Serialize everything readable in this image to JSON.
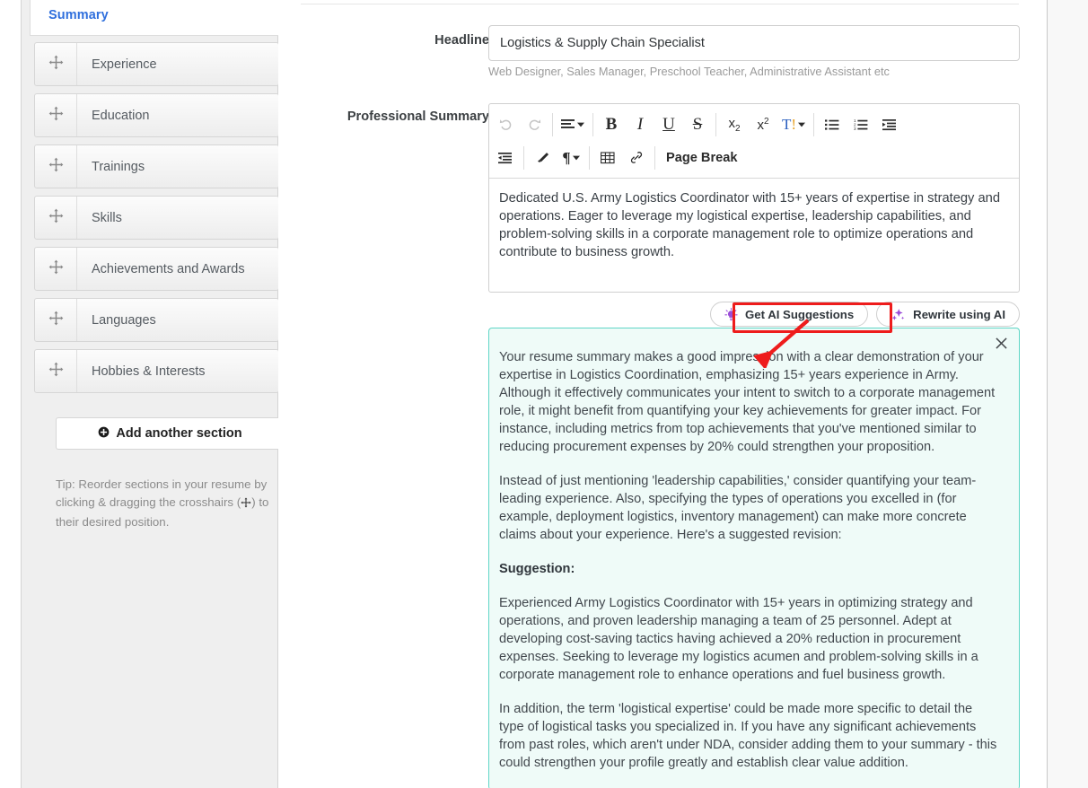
{
  "sidebar": {
    "active_tab": "Summary",
    "sections": [
      {
        "label": "Experience",
        "icon": "drag-crosshair-icon"
      },
      {
        "label": "Education",
        "icon": "drag-crosshair-icon"
      },
      {
        "label": "Trainings",
        "icon": "drag-crosshair-icon"
      },
      {
        "label": "Skills",
        "icon": "drag-crosshair-icon"
      },
      {
        "label": "Achievements and Awards",
        "icon": "drag-crosshair-icon"
      },
      {
        "label": "Languages",
        "icon": "drag-crosshair-icon"
      },
      {
        "label": "Hobbies & Interests",
        "icon": "drag-crosshair-icon"
      }
    ],
    "add_section_label": "Add another section",
    "add_section_icon": "plus-circle-icon",
    "tip_before": "Tip: Reorder sections in your resume by clicking & dragging the crosshairs (",
    "tip_after": ") to their desired position."
  },
  "form": {
    "headline_label": "Headline",
    "headline_value": "Logistics & Supply Chain Specialist",
    "headline_placeholder": "Logistics & Supply Chain Specialist",
    "headline_hint": "Web Designer, Sales Manager, Preschool Teacher, Administrative Assistant etc",
    "summary_label": "Professional Summary",
    "summary_text": "Dedicated U.S. Army Logistics Coordinator with 15+ years of expertise in strategy and operations. Eager to leverage my logistical expertise, leadership capabilities, and problem-solving skills in a corporate management role to optimize operations and contribute to business growth."
  },
  "editor_toolbar": {
    "row1": [
      {
        "name": "undo-icon",
        "glyph": "↺",
        "kind": "icon",
        "disabled": true
      },
      {
        "name": "redo-icon",
        "glyph": "↻",
        "kind": "icon",
        "disabled": true
      },
      {
        "name": "align-icon",
        "glyph": "≡",
        "kind": "icon-caret"
      },
      {
        "name": "bold-icon",
        "glyph": "B",
        "kind": "serif"
      },
      {
        "name": "italic-icon",
        "glyph": "I",
        "kind": "serif-italic"
      },
      {
        "name": "underline-icon",
        "glyph": "U",
        "kind": "serif-underline"
      },
      {
        "name": "strikethrough-icon",
        "glyph": "S",
        "kind": "serif-strike"
      },
      {
        "name": "subscript-icon",
        "glyph": "x₂",
        "kind": "script"
      },
      {
        "name": "superscript-icon",
        "glyph": "x²",
        "kind": "script"
      },
      {
        "name": "font-color-icon",
        "glyph": "T!",
        "kind": "icon-caret"
      },
      {
        "name": "unordered-list-icon",
        "glyph": "☰",
        "kind": "icon"
      },
      {
        "name": "ordered-list-icon",
        "glyph": "☰",
        "kind": "icon"
      },
      {
        "name": "indent-icon",
        "glyph": "▤",
        "kind": "icon"
      }
    ],
    "row2": [
      {
        "name": "outdent-icon",
        "glyph": "▤",
        "kind": "icon"
      },
      {
        "name": "clear-format-icon",
        "glyph": "▰",
        "kind": "icon"
      },
      {
        "name": "paragraph-icon",
        "glyph": "¶",
        "kind": "icon-caret"
      },
      {
        "name": "table-icon",
        "glyph": "▦",
        "kind": "icon"
      },
      {
        "name": "link-icon",
        "glyph": "🔗",
        "kind": "icon"
      },
      {
        "name": "page-break-button",
        "glyph": "Page Break",
        "kind": "text"
      }
    ]
  },
  "ai_buttons": {
    "get_suggestions_label": "Get AI Suggestions",
    "get_suggestions_icon": "lightbulb-icon",
    "rewrite_label": "Rewrite using AI",
    "rewrite_icon": "sparkles-icon",
    "highlight_color": "#ee1c1c",
    "accent_color": "#9b4dd8"
  },
  "suggestion_panel": {
    "close_icon": "close-icon",
    "border_color": "#5fd6c6",
    "background_color": "#effbf8",
    "paragraphs": [
      {
        "style": "body",
        "text": "Your resume summary makes a good impression with a clear demonstration of your expertise in Logistics Coordination, emphasizing 15+ years experience in Army. Although it effectively communicates your intent to switch to a corporate management role, it might benefit from quantifying your key achievements for greater impact. For instance, including metrics from top achievements that you've mentioned similar to reducing procurement expenses by 20% could strengthen your proposition."
      },
      {
        "style": "body",
        "text": "Instead of just mentioning 'leadership capabilities,' consider quantifying your team-leading experience. Also, specifying the types of operations you excelled in (for example, deployment logistics, inventory management) can make more concrete claims about your experience. Here's a suggested revision:"
      },
      {
        "style": "heading",
        "text": "Suggestion:"
      },
      {
        "style": "body",
        "text": "Experienced Army Logistics Coordinator with 15+ years in optimizing strategy and operations, and proven leadership managing a team of 25 personnel. Adept at developing cost-saving tactics having achieved a 20% reduction in procurement expenses. Seeking to leverage my logistics acumen and problem-solving skills in a corporate management role to enhance operations and fuel business growth."
      },
      {
        "style": "body",
        "text": "In addition, the term 'logistical expertise' could be made more specific to detail the type of logistical tasks you specialized in. If you have any significant achievements from past roles, which aren't under NDA, consider adding them to your summary - this could strengthen your profile greatly and establish clear value addition."
      }
    ]
  }
}
